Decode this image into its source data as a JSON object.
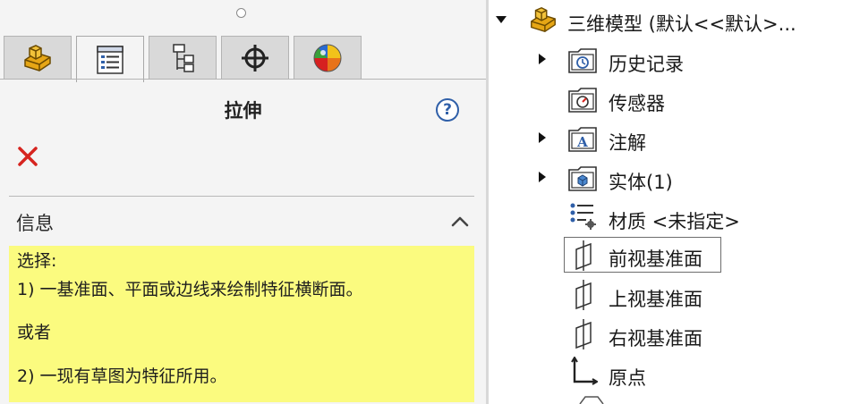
{
  "property_manager": {
    "tabs": [
      {
        "name": "feature-manager-tab",
        "icon": "part-icon"
      },
      {
        "name": "property-manager-tab",
        "icon": "property-list-icon"
      },
      {
        "name": "configuration-manager-tab",
        "icon": "configuration-icon"
      },
      {
        "name": "dimxpert-tab",
        "icon": "crosshair-icon"
      },
      {
        "name": "display-manager-tab",
        "icon": "color-wheel-icon"
      }
    ],
    "title": "拉伸",
    "help_label": "?",
    "cancel_label": "✕",
    "info_section": {
      "title": "信息",
      "lines": [
        "选择:",
        "1) 一基准面、平面或边线来绘制特征横断面。",
        "或者",
        "2) 一现有草图为特征所用。"
      ]
    },
    "colors": {
      "info_background": "#fbfb7f",
      "cancel": "#d6241f",
      "help": "#2f5fa8"
    }
  },
  "feature_tree": {
    "root_label": "三维模型 (默认<<默认>...",
    "items": [
      {
        "label": "历史记录",
        "icon": "history-folder-icon",
        "expandable": true
      },
      {
        "label": "传感器",
        "icon": "sensor-folder-icon",
        "expandable": false
      },
      {
        "label": "注解",
        "icon": "annotation-folder-icon",
        "expandable": true
      },
      {
        "label": "实体(1)",
        "icon": "solid-bodies-folder-icon",
        "expandable": true
      },
      {
        "label": "材质 <未指定>",
        "icon": "material-icon",
        "expandable": false
      },
      {
        "label": "前视基准面",
        "icon": "plane-icon",
        "expandable": false,
        "selected": true
      },
      {
        "label": "上视基准面",
        "icon": "plane-icon",
        "expandable": false
      },
      {
        "label": "右视基准面",
        "icon": "plane-icon",
        "expandable": false
      },
      {
        "label": "原点",
        "icon": "origin-icon",
        "expandable": false
      }
    ]
  }
}
